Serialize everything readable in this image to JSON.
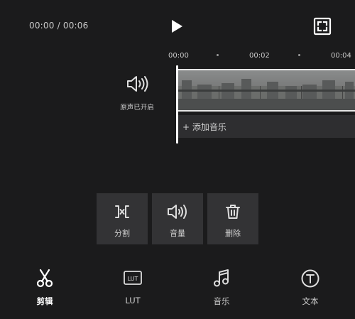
{
  "player": {
    "timecode": "00:00 / 00:06",
    "play_icon": "play-icon",
    "fullscreen_icon": "fullscreen-icon"
  },
  "ruler": {
    "ticks": [
      "00:00",
      "00:02",
      "00:04"
    ]
  },
  "tracks": {
    "original_sound_label": "原声已开启",
    "add_music_label": "+ 添加音乐"
  },
  "tools": [
    {
      "label": "分割",
      "icon": "split-icon"
    },
    {
      "label": "音量",
      "icon": "volume-icon"
    },
    {
      "label": "删除",
      "icon": "trash-icon"
    }
  ],
  "bottom_nav": [
    {
      "label": "剪辑",
      "icon": "scissors-icon",
      "active": true
    },
    {
      "label": "LUT",
      "icon": "lut-icon",
      "active": false
    },
    {
      "label": "音乐",
      "icon": "music-note-icon",
      "active": false
    },
    {
      "label": "文本",
      "icon": "text-icon",
      "active": false
    }
  ],
  "colors": {
    "background": "#1b1b1c",
    "tool_bg": "#333335",
    "track_bg": "#2e2e30",
    "playhead": "#ffffff"
  }
}
